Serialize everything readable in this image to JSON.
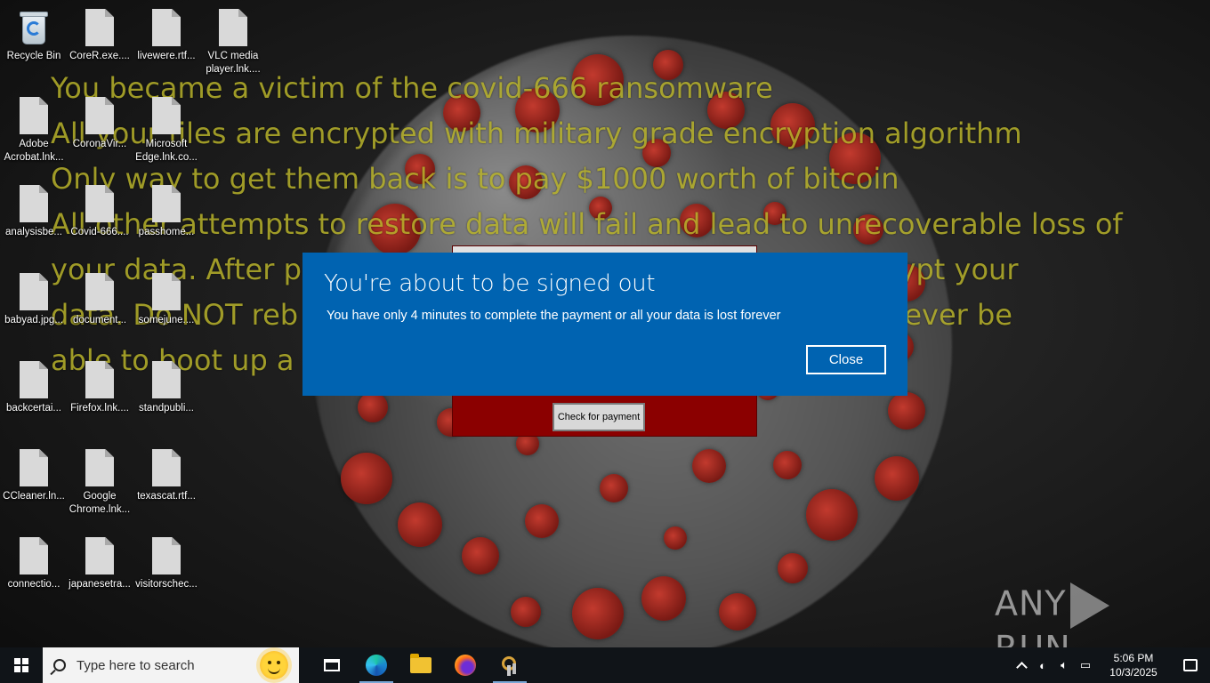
{
  "wallpaper": {
    "ransom_lines": [
      "You became a victim of the covid-666 ransomware",
      "All your files are encrypted with military grade encryption algorithm",
      "Only way to get them back is to pay $1000 worth of bitcoin",
      "All other attempts to restore data will fail and lead to unrecoverable loss of",
      "your data. After p                                                  on to decrypt your",
      "data. Do NOT reb                                                    you will never be",
      "able to boot up a                                                   inutes"
    ],
    "text_color": "#b7b22a"
  },
  "desktop_icons": [
    {
      "label": "Recycle Bin",
      "icon": "recycle-bin-icon"
    },
    {
      "label": "CoreR.exe....",
      "icon": "file-icon"
    },
    {
      "label": "livewere.rtf...",
      "icon": "file-icon"
    },
    {
      "label": "VLC media player.lnk....",
      "icon": "file-icon"
    },
    {
      "label": "Adobe Acrobat.lnk...",
      "icon": "file-icon"
    },
    {
      "label": "CoronaVir...",
      "icon": "file-icon"
    },
    {
      "label": "Microsoft Edge.lnk.co...",
      "icon": "file-icon"
    },
    {
      "label": "analysisbe...",
      "icon": "file-icon"
    },
    {
      "label": "Covid-666....",
      "icon": "file-icon"
    },
    {
      "label": "passhome...",
      "icon": "file-icon"
    },
    {
      "label": "babyad.jpg...",
      "icon": "file-icon"
    },
    {
      "label": "document...",
      "icon": "file-icon"
    },
    {
      "label": "somejune....",
      "icon": "file-icon"
    },
    {
      "label": "backcertai...",
      "icon": "file-icon"
    },
    {
      "label": "Firefox.lnk....",
      "icon": "file-icon"
    },
    {
      "label": "standpubli...",
      "icon": "file-icon"
    },
    {
      "label": "CCleaner.ln...",
      "icon": "file-icon"
    },
    {
      "label": "Google Chrome.lnk...",
      "icon": "file-icon"
    },
    {
      "label": "texascat.rtf...",
      "icon": "file-icon"
    },
    {
      "label": "connectio...",
      "icon": "file-icon"
    },
    {
      "label": "japanesetra...",
      "icon": "file-icon"
    },
    {
      "label": "visitorschec...",
      "icon": "file-icon"
    }
  ],
  "ransom_window": {
    "check_button_label": "Check for payment",
    "background_color": "#8b0000"
  },
  "dialog": {
    "title": "You're about to be signed out",
    "message": "You have only 4 minutes to complete the payment or all your data is lost forever",
    "close_label": "Close",
    "background_color": "#0063b1"
  },
  "watermark": {
    "left_text": "ANY",
    "right_text": "RUN"
  },
  "taskbar": {
    "search_placeholder": "Type here to search",
    "apps": [
      {
        "icon": "task-view-icon"
      },
      {
        "icon": "edge-icon"
      },
      {
        "icon": "file-explorer-icon"
      },
      {
        "icon": "firefox-icon"
      },
      {
        "icon": "ransomware-app-icon"
      }
    ],
    "clock_time": "5:06 PM",
    "clock_date": "10/3/2025"
  }
}
